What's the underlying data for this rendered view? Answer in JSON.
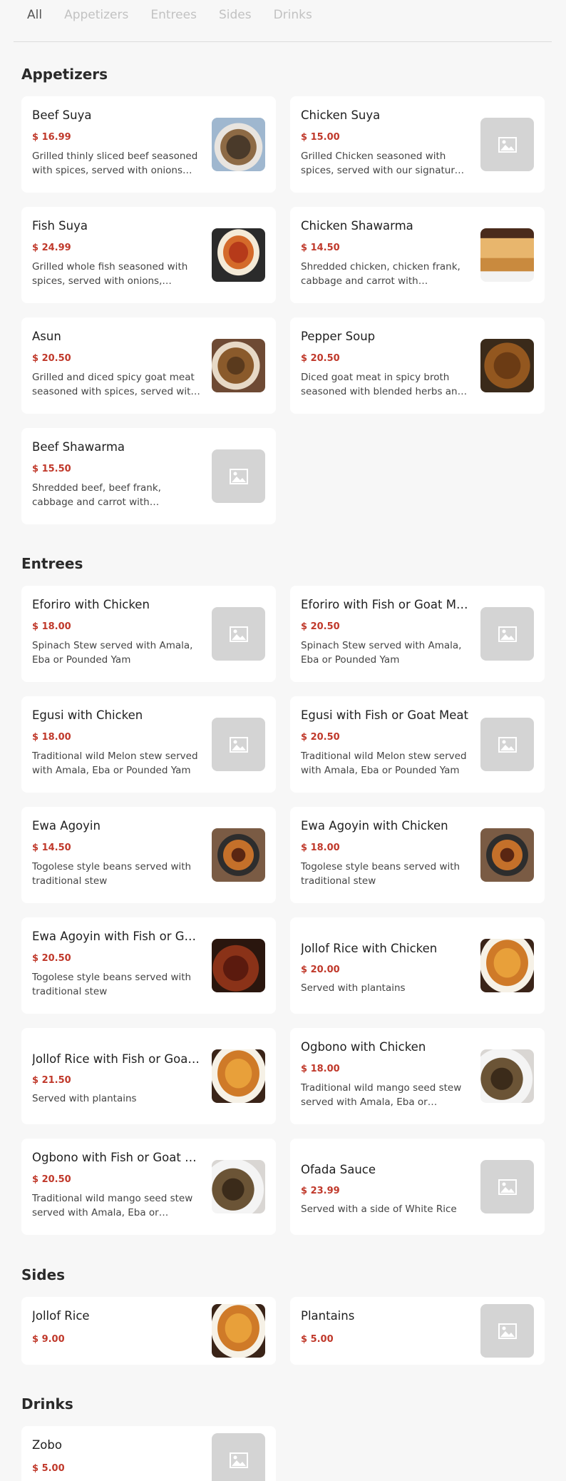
{
  "tabs": [
    "All",
    "Appetizers",
    "Entrees",
    "Sides",
    "Drinks"
  ],
  "sections": [
    {
      "title": "Appetizers",
      "items": [
        {
          "name": "Beef Suya",
          "price": "$ 16.99",
          "desc": "Grilled thinly sliced beef seasoned with spices, served with onions and tomatoes",
          "img": "food1"
        },
        {
          "name": "Chicken Suya",
          "price": "$ 15.00",
          "desc": "Grilled Chicken seasoned with spices, served with our signature sauce",
          "img": "placeholder"
        },
        {
          "name": "Fish Suya",
          "price": "$ 24.99",
          "desc": "Grilled whole fish seasoned with spices, served with onions, tomatoes",
          "img": "food2"
        },
        {
          "name": "Chicken Shawarma",
          "price": "$ 14.50",
          "desc": "Shredded chicken, chicken frank, cabbage and carrot with mayonnaise",
          "img": "food5"
        },
        {
          "name": "Asun",
          "price": "$ 20.50",
          "desc": "Grilled and diced spicy goat meat seasoned with spices, served with onions",
          "img": "food3"
        },
        {
          "name": "Pepper Soup",
          "price": "$ 20.50",
          "desc": "Diced goat meat in spicy broth seasoned with blended herbs and spices",
          "img": "food4"
        },
        {
          "name": "Beef Shawarma",
          "price": "$ 15.50",
          "desc": "Shredded beef, beef frank, cabbage and carrot with mayonnaise",
          "img": "placeholder"
        }
      ]
    },
    {
      "title": "Entrees",
      "items": [
        {
          "name": "Eforiro with Chicken",
          "price": "$ 18.00",
          "desc": "Spinach Stew served with Amala, Eba or Pounded Yam",
          "img": "placeholder"
        },
        {
          "name": "Eforiro with Fish or Goat Meat",
          "price": "$ 20.50",
          "desc": "Spinach Stew served with Amala, Eba or Pounded Yam",
          "img": "placeholder"
        },
        {
          "name": "Egusi with Chicken",
          "price": "$ 18.00",
          "desc": "Traditional wild Melon stew served with Amala, Eba or Pounded Yam",
          "img": "placeholder"
        },
        {
          "name": "Egusi with Fish or Goat Meat",
          "price": "$ 20.50",
          "desc": "Traditional wild Melon stew served with Amala, Eba or Pounded Yam",
          "img": "placeholder"
        },
        {
          "name": "Ewa Agoyin",
          "price": "$ 14.50",
          "desc": "Togolese style beans served with traditional stew",
          "img": "food6"
        },
        {
          "name": "Ewa Agoyin with Chicken",
          "price": "$ 18.00",
          "desc": "Togolese style beans served with traditional stew",
          "img": "food6"
        },
        {
          "name": "Ewa Agoyin with Fish or Goat Meat",
          "price": "$ 20.50",
          "desc": "Togolese style beans served with traditional stew",
          "img": "food7"
        },
        {
          "name": "Jollof Rice with Chicken",
          "price": "$ 20.00",
          "desc": "Served with plantains",
          "img": "food8"
        },
        {
          "name": "Jollof Rice with Fish or Goat Meat",
          "price": "$ 21.50",
          "desc": "Served with plantains",
          "img": "food8"
        },
        {
          "name": "Ogbono with Chicken",
          "price": "$ 18.00",
          "desc": "Traditional wild mango seed stew served with Amala, Eba or Pounded Yam",
          "img": "food9"
        },
        {
          "name": "Ogbono with Fish or Goat Meat",
          "price": "$ 20.50",
          "desc": "Traditional wild mango seed stew served with Amala, Eba or Pounded Yam",
          "img": "food9"
        },
        {
          "name": "Ofada Sauce",
          "price": "$ 23.99",
          "desc": "Served with a side of White Rice",
          "img": "placeholder"
        }
      ]
    },
    {
      "title": "Sides",
      "items": [
        {
          "name": "Jollof Rice",
          "price": "$ 9.00",
          "desc": "",
          "img": "food8"
        },
        {
          "name": "Plantains",
          "price": "$ 5.00",
          "desc": "",
          "img": "placeholder"
        }
      ]
    },
    {
      "title": "Drinks",
      "items": [
        {
          "name": "Zobo",
          "price": "$ 5.00",
          "desc": "",
          "img": "placeholder"
        }
      ]
    }
  ],
  "colors": {
    "price": "#c0392b",
    "background": "#f7f7f7",
    "card": "#ffffff",
    "placeholder": "#d4d4d4"
  },
  "icons": {
    "placeholder": "image-placeholder-icon"
  }
}
